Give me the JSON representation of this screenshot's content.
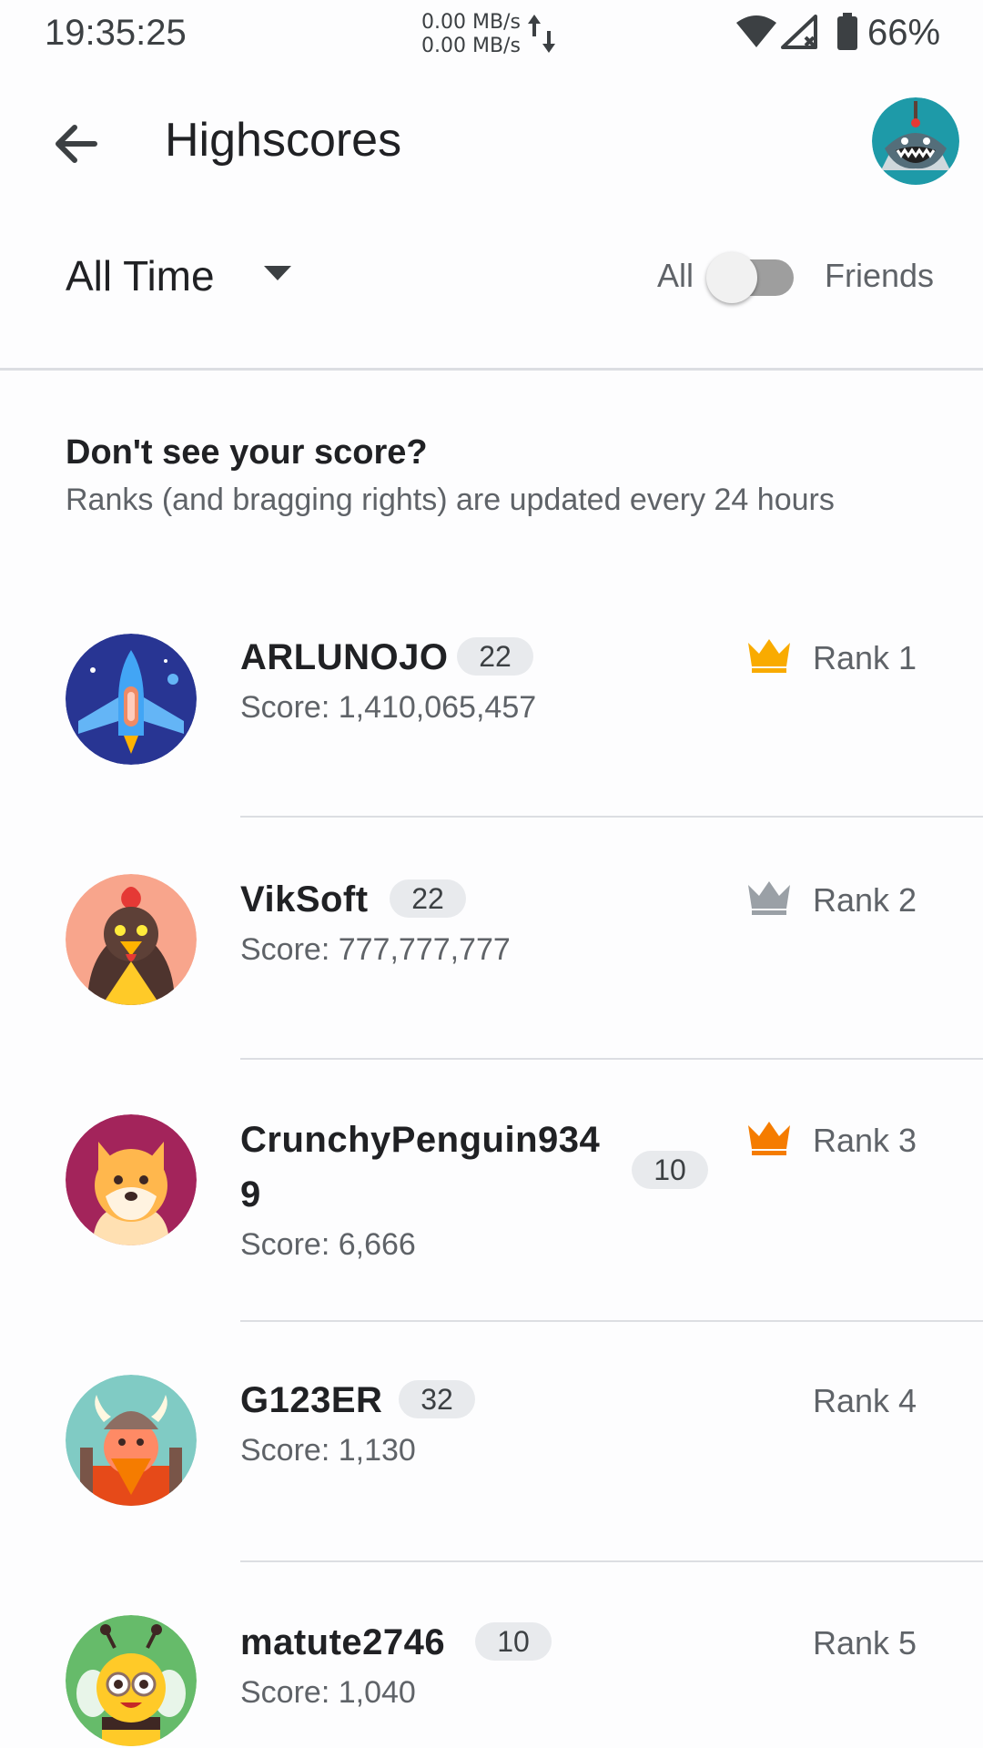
{
  "status_bar": {
    "time": "19:35:25",
    "net_up": "0.00 MB/s",
    "net_down": "0.00 MB/s",
    "battery": "66%",
    "icons": [
      "data-transfer-icon",
      "wifi-icon",
      "signal-icon",
      "battery-icon"
    ]
  },
  "app_bar": {
    "title": "Highscores",
    "back_icon": "arrow-left-icon",
    "avatar_icon": "shark-avatar"
  },
  "filters": {
    "time_range": "All Time",
    "toggle_left": "All",
    "toggle_right": "Friends",
    "toggle_on": false
  },
  "info": {
    "heading": "Don't see your score?",
    "subtext": "Ranks (and bragging rights) are updated every 24 hours"
  },
  "leaderboard": [
    {
      "name": "ARLUNOJO",
      "level": "22",
      "score": "Score: 1,410,065,457",
      "rank": "Rank 1",
      "crown": "gold",
      "avatar": "spaceship-avatar"
    },
    {
      "name": "VikSoft",
      "level": "22",
      "score": "Score: 777,777,777",
      "rank": "Rank 2",
      "crown": "silver",
      "avatar": "rooster-avatar"
    },
    {
      "name_line1": "CrunchyPenguin934",
      "name_line2": "9",
      "level": "10",
      "score": "Score: 6,666",
      "rank": "Rank 3",
      "crown": "bronze",
      "avatar": "shiba-dog-avatar"
    },
    {
      "name": "G123ER",
      "level": "32",
      "score": "Score: 1,130",
      "rank": "Rank 4",
      "avatar": "viking-avatar"
    },
    {
      "name": "matute2746",
      "level": "10",
      "score": "Score: 1,040",
      "rank": "Rank 5",
      "avatar": "bee-avatar"
    }
  ],
  "colors": {
    "gold": "#f9ab00",
    "silver": "#9aa0a6",
    "bronze": "#f57c00",
    "chip": "#e8eaed",
    "divider": "#dcdee2"
  }
}
